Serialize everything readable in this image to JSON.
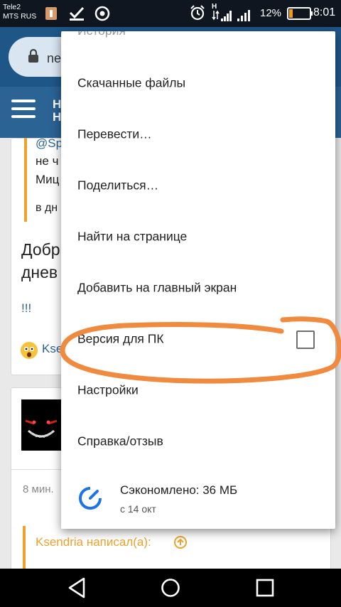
{
  "status_bar": {
    "carrier_line1": "Tele2",
    "carrier_line2": "MTS RUS",
    "network_type": "H",
    "battery_percent": "12%",
    "time": "8:01"
  },
  "browser": {
    "url_partial": "ne"
  },
  "site_nav": {
    "title_partial_1": "Н",
    "title_partial_2": "Н"
  },
  "background": {
    "mention_partial": "@Sp",
    "line_2": "не ч",
    "line_3": "Миц",
    "line_4": "в дн",
    "big_text_1": "Добр",
    "big_text_2": "днев",
    "exclaim": "!!!",
    "user_partial": "Kse",
    "time_partial": "8 мин.",
    "quote_author": "Ksendria написал(а):"
  },
  "menu": {
    "partial_top": "История",
    "items": [
      {
        "label": "Скачанные файлы"
      },
      {
        "label": "Перевести…"
      },
      {
        "label": "Поделиться…"
      },
      {
        "label": "Найти на странице"
      },
      {
        "label": "Добавить на главный экран"
      },
      {
        "label": "Версия для ПК"
      },
      {
        "label": "Настройки"
      },
      {
        "label": "Справка/отзыв"
      }
    ],
    "desktop_checked": false,
    "savings": {
      "title": "Сэкономлено: 36 МБ",
      "subtitle": "с 14 окт"
    }
  },
  "colors": {
    "app_bar": "#1f5688",
    "nav_bar": "#2a6394",
    "accent_orange": "#f0a12b",
    "annotation_orange": "#f08a3e",
    "savings_blue": "#1a73e8"
  }
}
